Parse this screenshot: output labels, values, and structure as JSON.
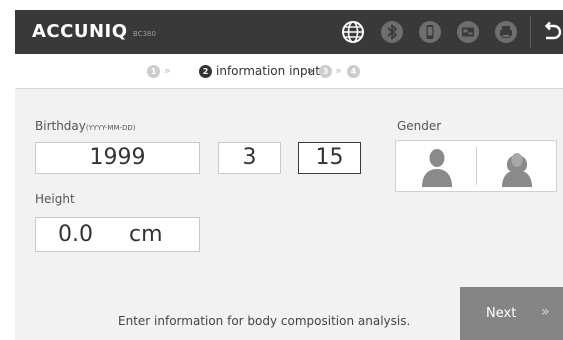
{
  "header": {
    "brand": "ACCUNIQ",
    "model": "BC380",
    "icons": [
      "globe-icon",
      "bluetooth-icon",
      "phone-icon",
      "card-reader-icon",
      "printer-icon",
      "back-icon"
    ]
  },
  "steps": {
    "items": [
      {
        "number": "1",
        "state": "inactive"
      },
      {
        "number": "2",
        "state": "active",
        "label": "information input"
      },
      {
        "number": "3",
        "state": "inactive"
      },
      {
        "number": "4",
        "state": "inactive"
      }
    ],
    "separator": "»"
  },
  "form": {
    "birthday": {
      "label": "Birthday",
      "format": "(YYYY-MM-DD)",
      "year": "1999",
      "month": "3",
      "day": "15"
    },
    "gender": {
      "label": "Gender",
      "options": [
        "male-icon",
        "female-icon"
      ]
    },
    "height": {
      "label": "Height",
      "value": "0.0",
      "unit": "cm"
    }
  },
  "footer": {
    "hint": "Enter information for body composition analysis.",
    "next_label": "Next",
    "next_chevron": "»"
  },
  "colors": {
    "header_bg": "#393939",
    "content_bg": "#f2f2f2",
    "next_bg": "#858585"
  }
}
